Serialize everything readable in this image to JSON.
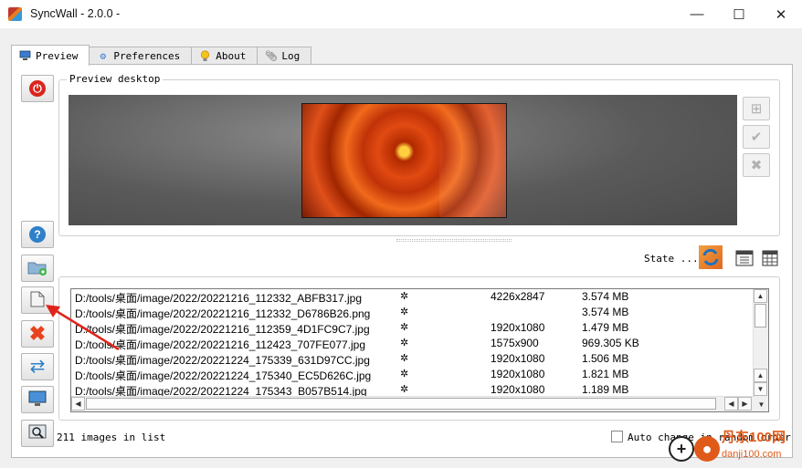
{
  "window": {
    "title": "SyncWall - 2.0.0 -",
    "controls": {
      "minimize": "—",
      "maximize": "☐",
      "close": "✕"
    }
  },
  "tabs": [
    {
      "label": "Preview",
      "icon": "monitor-icon",
      "active": true
    },
    {
      "label": "Preferences",
      "icon": "gear-icon",
      "active": false
    },
    {
      "label": "About",
      "icon": "lightbulb-icon",
      "active": false
    },
    {
      "label": "Log",
      "icon": "paperclip-icon",
      "active": false
    }
  ],
  "preview": {
    "group_title": "Preview desktop",
    "side_buttons": [
      "plus-icon",
      "check-icon",
      "close-icon"
    ]
  },
  "state": {
    "label": "State ...",
    "icons": [
      "sync-state-icon",
      "calendar-icon",
      "table-icon"
    ]
  },
  "left_toolbar": [
    "power-icon",
    "help-icon",
    "add-folder-icon",
    "add-file-icon",
    "delete-icon",
    "refresh-icon",
    "set-wallpaper-icon",
    "view-image-icon"
  ],
  "files": [
    {
      "path": "D:/tools/桌面/image/2022/20221216_112332_ABFB317.jpg",
      "star": "✲",
      "resolution": "4226x2847",
      "size": "3.574 MB"
    },
    {
      "path": "D:/tools/桌面/image/2022/20221216_112332_D6786B26.png",
      "star": "✲",
      "resolution": "",
      "size": "3.574 MB"
    },
    {
      "path": "D:/tools/桌面/image/2022/20221216_112359_4D1FC9C7.jpg",
      "star": "✲",
      "resolution": "1920x1080",
      "size": "1.479 MB"
    },
    {
      "path": "D:/tools/桌面/image/2022/20221216_112423_707FE077.jpg",
      "star": "✲",
      "resolution": "1575x900",
      "size": "969.305 KB"
    },
    {
      "path": "D:/tools/桌面/image/2022/20221224_175339_631D97CC.jpg",
      "star": "✲",
      "resolution": "1920x1080",
      "size": "1.506 MB"
    },
    {
      "path": "D:/tools/桌面/image/2022/20221224_175340_EC5D626C.jpg",
      "star": "✲",
      "resolution": "1920x1080",
      "size": "1.821 MB"
    },
    {
      "path": "D:/tools/桌面/image/2022/20221224_175343_B057B514.jpg",
      "star": "✲",
      "resolution": "1920x1080",
      "size": "1.189 MB"
    }
  ],
  "status": {
    "count_text": "211 images in list",
    "auto_change_label": "Auto change in random order",
    "auto_change_checked": false
  },
  "watermark": {
    "text": "丹东100网",
    "sub": "danji100.com"
  },
  "colors": {
    "accent_red": "#d9251d",
    "help_blue": "#2f80c8",
    "arrow_red": "#e0241b"
  }
}
